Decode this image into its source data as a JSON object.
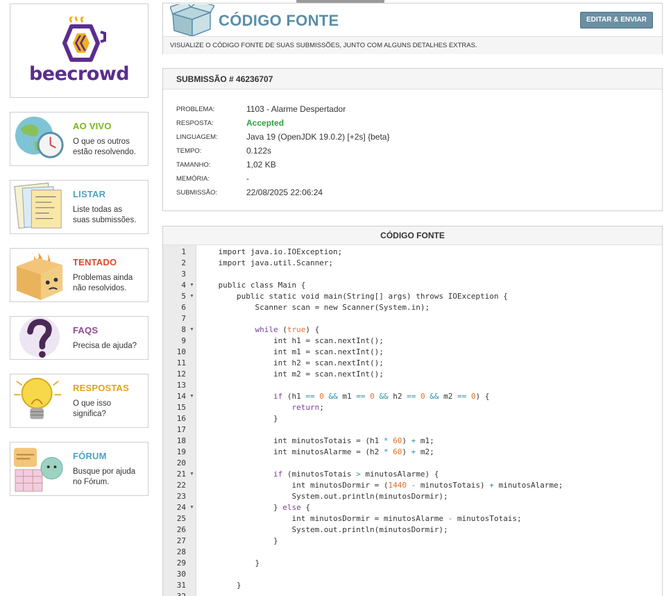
{
  "sidebar": {
    "logo_text": "beecrowd",
    "cards": [
      {
        "title": "AO VIVO",
        "desc_line1": "O que os outros",
        "desc_line2": "estão resolvendo.",
        "color": "#7ab51d",
        "icon": "globe-clock-icon"
      },
      {
        "title": "LISTAR",
        "desc_line1": "Liste todas as",
        "desc_line2": "suas submissões.",
        "color": "#4aa3c4",
        "icon": "papers-icon"
      },
      {
        "title": "TENTADO",
        "desc_line1": "Problemas ainda",
        "desc_line2": "não resolvidos.",
        "color": "#e0462d",
        "icon": "burning-box-icon"
      },
      {
        "title": "FAQS",
        "desc_line1": "Precisa de ajuda?",
        "desc_line2": "",
        "color": "#8e4a8e",
        "icon": "question-mark-icon"
      },
      {
        "title": "RESPOSTAS",
        "desc_line1": "O que isso",
        "desc_line2": "significa?",
        "color": "#e3a21a",
        "icon": "lightbulb-icon"
      },
      {
        "title": "FÓRUM",
        "desc_line1": "Busque por ajuda",
        "desc_line2": "no Fórum.",
        "color": "#4aa3c4",
        "icon": "forum-chat-icon"
      }
    ]
  },
  "header": {
    "title": "CÓDIGO FONTE",
    "edit_button": "EDITAR & ENVIAR",
    "subtitle": "VISUALIZE O CÓDIGO FONTE DE SUAS SUBMISSÕES, JUNTO COM ALGUNS DETALHES EXTRAS."
  },
  "submission": {
    "heading": "SUBMISSÃO # 46236707",
    "rows": [
      {
        "label": "PROBLEMA:",
        "value": "1103 - Alarme Despertador"
      },
      {
        "label": "RESPOSTA:",
        "value": "Accepted"
      },
      {
        "label": "LINGUAGEM:",
        "value": "Java 19 (OpenJDK 19.0.2) [+2s] {beta}"
      },
      {
        "label": "TEMPO:",
        "value": "0.122s"
      },
      {
        "label": "TAMANHO:",
        "value": "1,02 KB"
      },
      {
        "label": "MEMÓRIA:",
        "value": "-"
      },
      {
        "label": "SUBMISSÃO:",
        "value": "22/08/2025 22:06:24"
      }
    ]
  },
  "code": {
    "heading": "CÓDIGO FONTE",
    "fold_lines": [
      4,
      5,
      8,
      14,
      21,
      24
    ],
    "lines": [
      "    import java.io.IOException;",
      "    import java.util.Scanner;",
      "",
      "    public class Main {",
      "        public static void main(String[] args) throws IOException {",
      "            Scanner scan = new Scanner(System.in);",
      "",
      "            while (true) {",
      "                int h1 = scan.nextInt();",
      "                int m1 = scan.nextInt();",
      "                int h2 = scan.nextInt();",
      "                int m2 = scan.nextInt();",
      "",
      "                if (h1 == 0 && m1 == 0 && h2 == 0 && m2 == 0) {",
      "                    return;",
      "                }",
      "",
      "                int minutosTotais = (h1 * 60) + m1;",
      "                int minutosAlarme = (h2 * 60) + m2;",
      "",
      "                if (minutosTotais > minutosAlarme) {",
      "                    int minutosDormir = (1440 - minutosTotais) + minutosAlarme;",
      "                    System.out.println(minutosDormir);",
      "                } else {",
      "                    int minutosDormir = minutosAlarme - minutosTotais;",
      "                    System.out.println(minutosDormir);",
      "                }",
      "",
      "            }",
      "",
      "        }",
      ""
    ]
  }
}
